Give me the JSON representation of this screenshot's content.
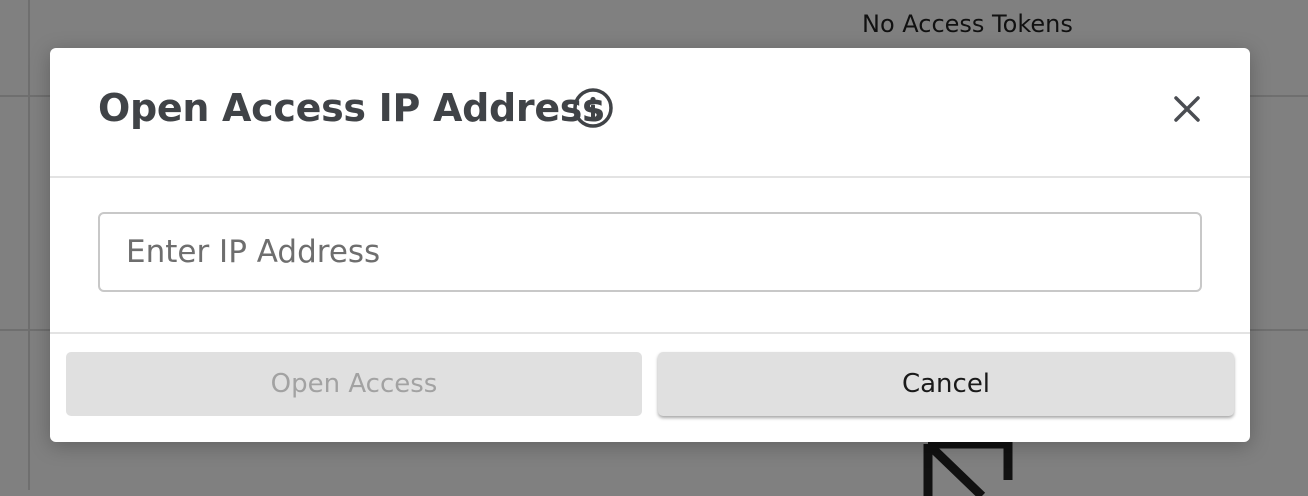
{
  "background": {
    "access_tokens_text": "No Access Tokens"
  },
  "modal": {
    "title": "Open Access IP Address",
    "info_icon": "info-circle-icon",
    "close_icon": "close-icon",
    "ip_input": {
      "value": "",
      "placeholder": "Enter IP Address"
    },
    "buttons": {
      "open_access_label": "Open Access",
      "open_access_disabled": true,
      "cancel_label": "Cancel"
    }
  },
  "colors": {
    "overlay": "#808080",
    "title": "#404347",
    "disabled_text": "#a2a2a2",
    "button_bg": "#e0e0e0"
  }
}
